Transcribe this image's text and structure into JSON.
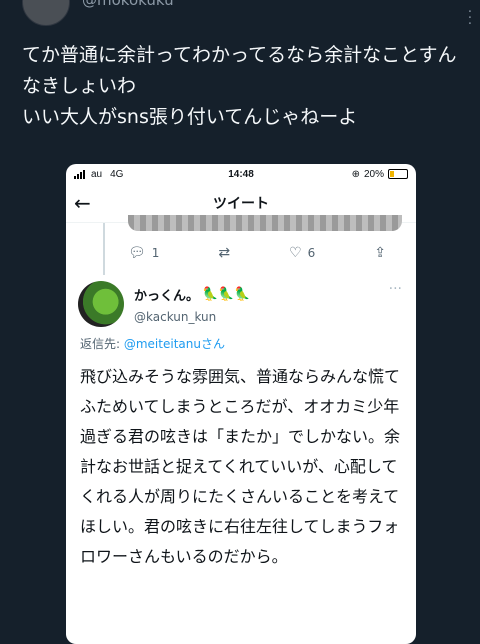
{
  "top": {
    "handle": "@mokokuku",
    "body": "てか普通に余計ってわかってるなら余計なことすんなきしょいわ\nいい大人がsns張り付いてんじゃねーよ"
  },
  "card": {
    "status": {
      "carrier": "au",
      "network": "4G",
      "time": "14:48",
      "battery": "20%"
    },
    "nav": {
      "back_glyph": "←",
      "title": "ツイート"
    },
    "prev_actions": {
      "reply_count": "1",
      "retweet_count": "",
      "like_count": "6"
    },
    "reply": {
      "display_name": "かっくん。",
      "emoji": "🦜🦜🦜",
      "handle": "@kackun_kun",
      "replying_prefix": "返信先: ",
      "replying_to": "@meiteitanu",
      "replying_suffix": "さん",
      "text": "飛び込みそうな雰囲気、普通ならみんな慌てふためいてしまうところだが、オオカミ少年過ぎる君の呟きは「またか」でしかない。余計なお世話と捉えてくれていいが、心配してくれる人が周りにたくさんいることを考えてほしい。君の呟きに右往左往してしまうフォロワーさんもいるのだから。"
    }
  },
  "colors": {
    "background": "#15202b",
    "accent": "#1d9bf0",
    "card": "#ffffff"
  }
}
